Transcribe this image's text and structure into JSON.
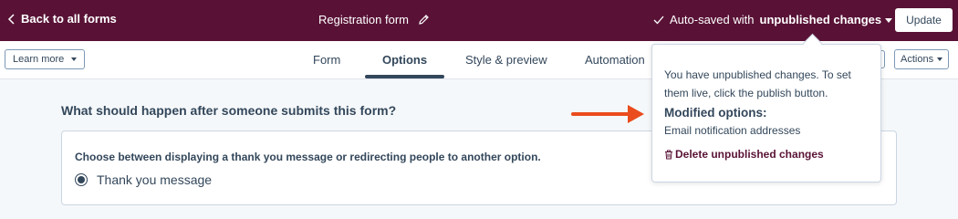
{
  "topbar": {
    "back_label": "Back to all forms",
    "form_title": "Registration form",
    "autosave_prefix": "Auto-saved with",
    "autosave_status": "unpublished changes",
    "update_label": "Update"
  },
  "tabbar": {
    "learn_more": "Learn more",
    "tabs": [
      {
        "label": "Form"
      },
      {
        "label": "Options"
      },
      {
        "label": "Style & preview"
      },
      {
        "label": "Automation"
      }
    ],
    "active_tab": "Options",
    "actions_label": "Actions"
  },
  "main": {
    "question": "What should happen after someone submits this form?",
    "card_heading": "Choose between displaying a thank you message or redirecting people to another option.",
    "radio_option": "Thank you message",
    "radio_selected": true
  },
  "popover": {
    "message": "You have unpublished changes. To set them live, click the publish button.",
    "heading": "Modified options:",
    "item": "Email notification addresses",
    "delete_label": "Delete unpublished changes"
  },
  "colors": {
    "brand": "#591236",
    "arrow": "#ea4c1d",
    "text": "#33475b"
  }
}
